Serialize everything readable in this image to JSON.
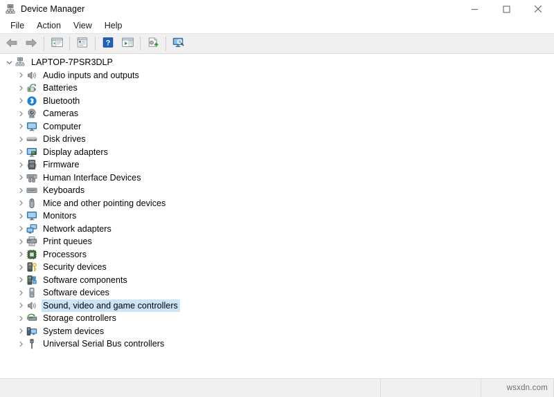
{
  "window": {
    "title": "Device Manager",
    "icon": "device-manager-icon",
    "controls": {
      "minimize": "minimize-icon",
      "maximize": "maximize-icon",
      "close": "close-icon"
    }
  },
  "menubar": {
    "items": [
      {
        "label": "File"
      },
      {
        "label": "Action"
      },
      {
        "label": "View"
      },
      {
        "label": "Help"
      }
    ]
  },
  "toolbar": {
    "buttons": [
      {
        "name": "back-button",
        "icon": "back-arrow-icon"
      },
      {
        "name": "forward-button",
        "icon": "forward-arrow-icon"
      },
      {
        "name": "show-hide-console-tree-button",
        "icon": "console-tree-icon"
      },
      {
        "name": "properties-button",
        "icon": "properties-icon"
      },
      {
        "name": "help-button",
        "icon": "help-question-icon"
      },
      {
        "name": "scan-for-hardware-changes-button",
        "icon": "scan-window-icon"
      },
      {
        "name": "update-driver-button",
        "icon": "update-driver-icon"
      },
      {
        "name": "display-devices-button",
        "icon": "monitor-search-icon"
      }
    ]
  },
  "tree": {
    "root": {
      "label": "LAPTOP-7PSR3DLP",
      "icon": "computer-node-icon",
      "expanded": true
    },
    "nodes": [
      {
        "label": "Audio inputs and outputs",
        "icon": "speaker-icon",
        "selected": false
      },
      {
        "label": "Batteries",
        "icon": "battery-icon",
        "selected": false
      },
      {
        "label": "Bluetooth",
        "icon": "bluetooth-icon",
        "selected": false
      },
      {
        "label": "Cameras",
        "icon": "camera-icon",
        "selected": false
      },
      {
        "label": "Computer",
        "icon": "monitor-icon",
        "selected": false
      },
      {
        "label": "Disk drives",
        "icon": "disk-drive-icon",
        "selected": false
      },
      {
        "label": "Display adapters",
        "icon": "display-adapter-icon",
        "selected": false
      },
      {
        "label": "Firmware",
        "icon": "firmware-chip-icon",
        "selected": false
      },
      {
        "label": "Human Interface Devices",
        "icon": "hid-icon",
        "selected": false
      },
      {
        "label": "Keyboards",
        "icon": "keyboard-icon",
        "selected": false
      },
      {
        "label": "Mice and other pointing devices",
        "icon": "mouse-icon",
        "selected": false
      },
      {
        "label": "Monitors",
        "icon": "monitor-icon",
        "selected": false
      },
      {
        "label": "Network adapters",
        "icon": "network-adapter-icon",
        "selected": false
      },
      {
        "label": "Print queues",
        "icon": "printer-icon",
        "selected": false
      },
      {
        "label": "Processors",
        "icon": "processor-icon",
        "selected": false
      },
      {
        "label": "Security devices",
        "icon": "security-key-icon",
        "selected": false
      },
      {
        "label": "Software components",
        "icon": "software-component-icon",
        "selected": false
      },
      {
        "label": "Software devices",
        "icon": "software-device-icon",
        "selected": false
      },
      {
        "label": "Sound, video and game controllers",
        "icon": "speaker-icon",
        "selected": true
      },
      {
        "label": "Storage controllers",
        "icon": "storage-controller-icon",
        "selected": false
      },
      {
        "label": "System devices",
        "icon": "system-device-icon",
        "selected": false
      },
      {
        "label": "Universal Serial Bus controllers",
        "icon": "usb-icon",
        "selected": false
      }
    ]
  },
  "statusbar": {
    "pane1": "",
    "pane2": "",
    "watermark": "wsxdn.com"
  },
  "colors": {
    "selection": "#cce4f7",
    "toolbar_bg": "#f0f0f0",
    "statusbar_bg": "#f0f0f0",
    "text": "#000000",
    "accent_blue": "#2c6fbb"
  }
}
